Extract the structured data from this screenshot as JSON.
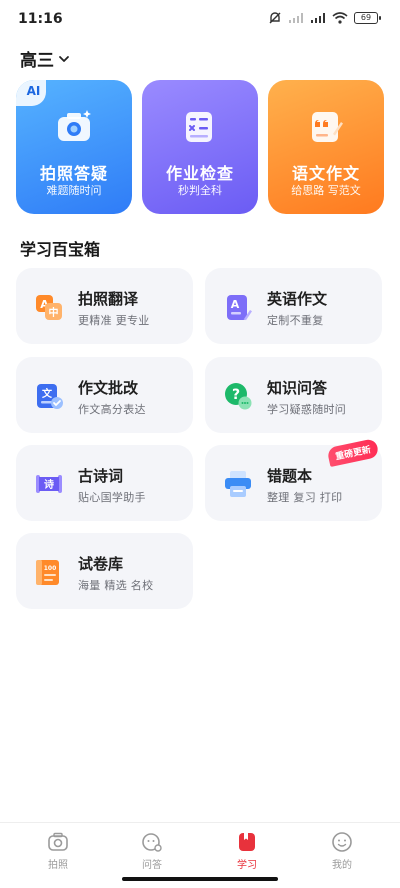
{
  "status_bar": {
    "time": "11:16",
    "battery": "69",
    "icons": [
      "mute-bell-icon",
      "signal-icon",
      "signal-icon",
      "wifi-icon",
      "battery-icon"
    ]
  },
  "grade_selector": {
    "label": "高三",
    "icon": "chevron-down-icon"
  },
  "hero_cards": [
    {
      "title": "拍照答疑",
      "subtitle": "难题随时问",
      "badge": "AI",
      "icon": "camera-icon",
      "color": "#3d8ef9"
    },
    {
      "title": "作业检查",
      "subtitle": "秒判全科",
      "icon": "homework-check-icon",
      "color": "#7d6ef8"
    },
    {
      "title": "语文作文",
      "subtitle": "给思路 写范文",
      "icon": "composition-icon",
      "color": "#ff8a2a"
    }
  ],
  "section": {
    "title": "学习百宝箱"
  },
  "tools": [
    {
      "title": "拍照翻译",
      "subtitle": "更精准 更专业",
      "icon": "translate-icon"
    },
    {
      "title": "英语作文",
      "subtitle": "定制不重复",
      "icon": "english-essay-icon"
    },
    {
      "title": "作文批改",
      "subtitle": "作文高分表达",
      "icon": "essay-correction-icon"
    },
    {
      "title": "知识问答",
      "subtitle": "学习疑惑随时问",
      "icon": "qa-icon"
    },
    {
      "title": "古诗词",
      "subtitle": "贴心国学助手",
      "icon": "poetry-icon"
    },
    {
      "title": "错题本",
      "subtitle": "整理 复习 打印",
      "icon": "printer-icon",
      "badge": "重磅更新"
    },
    {
      "title": "试卷库",
      "subtitle": "海量 精选 名校",
      "icon": "exam-paper-icon"
    }
  ],
  "bottom_nav": [
    {
      "label": "拍照",
      "icon": "camera-icon",
      "active": false
    },
    {
      "label": "问答",
      "icon": "chat-icon",
      "active": false
    },
    {
      "label": "学习",
      "icon": "book-icon",
      "active": true
    },
    {
      "label": "我的",
      "icon": "profile-icon",
      "active": false
    }
  ],
  "colors": {
    "accent": "#e8323c",
    "card_bg": "#f4f5f9"
  }
}
